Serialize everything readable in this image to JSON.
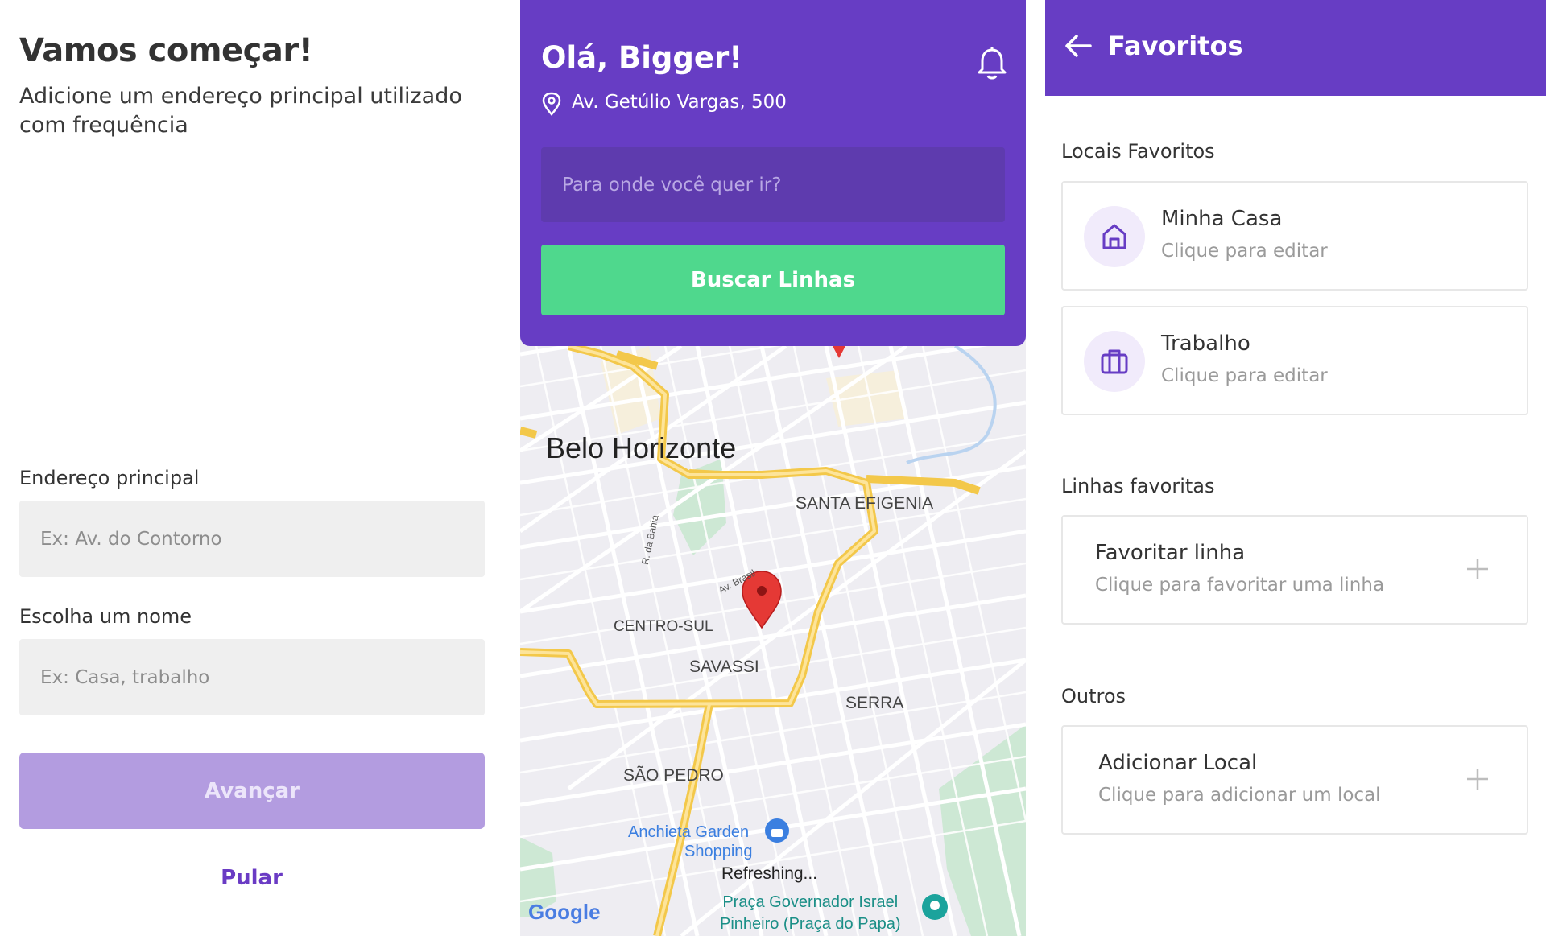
{
  "onboarding": {
    "title": "Vamos começar!",
    "subtitle": "Adicione um endereço principal utilizado com frequência",
    "address_label": "Endereço principal",
    "address_placeholder": "Ex: Av. do Contorno",
    "name_label": "Escolha um nome",
    "name_placeholder": "Ex: Casa, trabalho",
    "next_label": "Avançar",
    "skip_label": "Pular",
    "colors": {
      "accent": "#673dc4",
      "button_disabled": "#b39ce0",
      "input_bg": "#efefef"
    }
  },
  "home": {
    "greeting": "Olá, Bigger!",
    "address": "Av. Getúlio Vargas, 500",
    "search_placeholder": "Para onde você quer ir?",
    "search_button": "Buscar Linhas",
    "icons": [
      "bell-icon",
      "location-pin-icon"
    ],
    "colors": {
      "header": "#673dc4",
      "search_bg": "#5e3bae",
      "button": "#4fd88d"
    },
    "map": {
      "city": "Belo Horizonte",
      "neighborhoods": [
        "SANTA EFIGENIA",
        "CENTRO-SUL",
        "SAVASSI",
        "SERRA",
        "SÃO PEDRO"
      ],
      "streets": [
        "R. da Bahia",
        "Av. Brasil"
      ],
      "pois": [
        "Anchieta Garden Shopping",
        "Praça Governador Israel Pinheiro (Praça do Papa)"
      ],
      "poi_line1": "Anchieta Garden",
      "poi_line2": "Shopping",
      "poi2_line1": "Praça Governador Israel",
      "poi2_line2": "Pinheiro (Praça do Papa)",
      "status": "Refreshing...",
      "logo": "Google"
    }
  },
  "favorites": {
    "title": "Favoritos",
    "section_places": "Locais Favoritos",
    "places": [
      {
        "title": "Minha Casa",
        "subtitle": "Clique para editar",
        "icon": "home-icon"
      },
      {
        "title": "Trabalho",
        "subtitle": "Clique para editar",
        "icon": "briefcase-icon"
      }
    ],
    "section_lines": "Linhas favoritas",
    "line_card": {
      "title": "Favoritar linha",
      "subtitle": "Clique para favoritar uma linha"
    },
    "section_other": "Outros",
    "other_card": {
      "title": "Adicionar Local",
      "subtitle": "Clique para adicionar um local"
    },
    "colors": {
      "header": "#673dc4",
      "icon_bg": "#f1ebfb",
      "icon": "#673dc4"
    }
  }
}
